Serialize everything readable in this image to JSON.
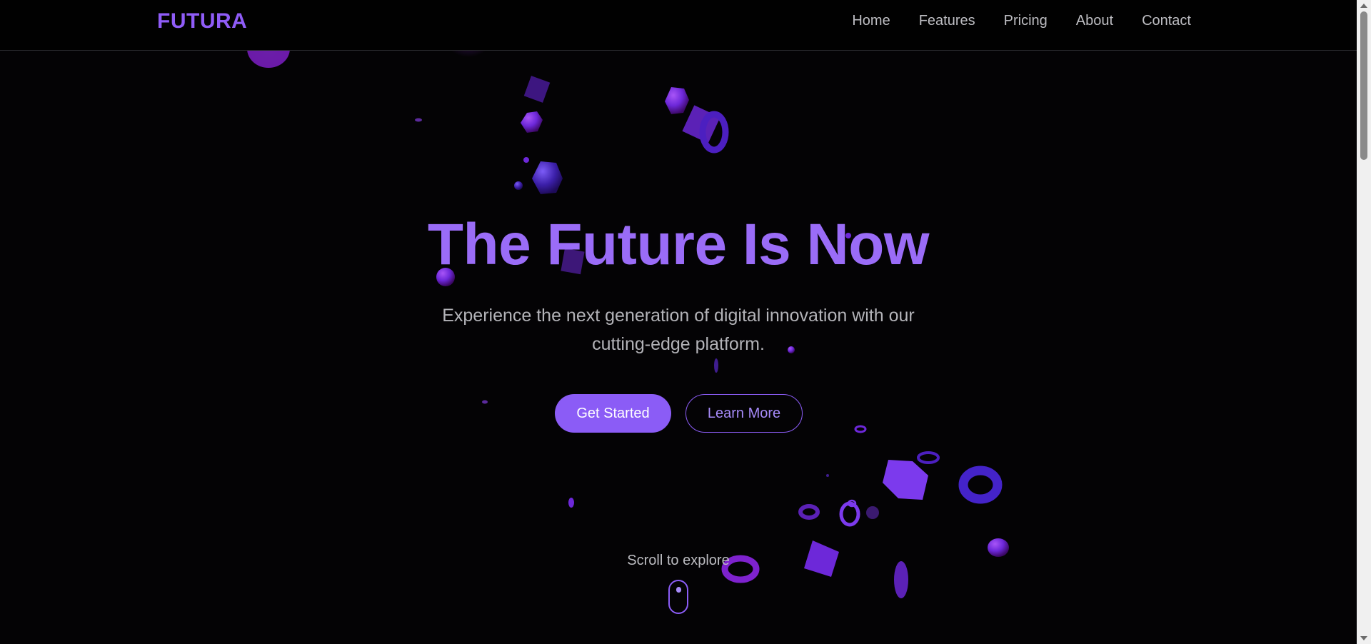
{
  "nav": {
    "logo": "FUTURA",
    "links": [
      "Home",
      "Features",
      "Pricing",
      "About",
      "Contact"
    ]
  },
  "hero": {
    "title": "The Future Is Now",
    "subtitle": "Experience the next generation of digital innovation with our cutting-edge platform.",
    "primary_button": "Get Started",
    "secondary_button": "Learn More",
    "scroll_hint": "Scroll to explore"
  },
  "colors": {
    "accent": "#8b5cf6",
    "accent_light": "#a78bfa",
    "background": "#040305",
    "text_muted": "#b3b3b8"
  },
  "icons": [
    "mouse-scroll-icon",
    "floating-3d-shapes"
  ]
}
